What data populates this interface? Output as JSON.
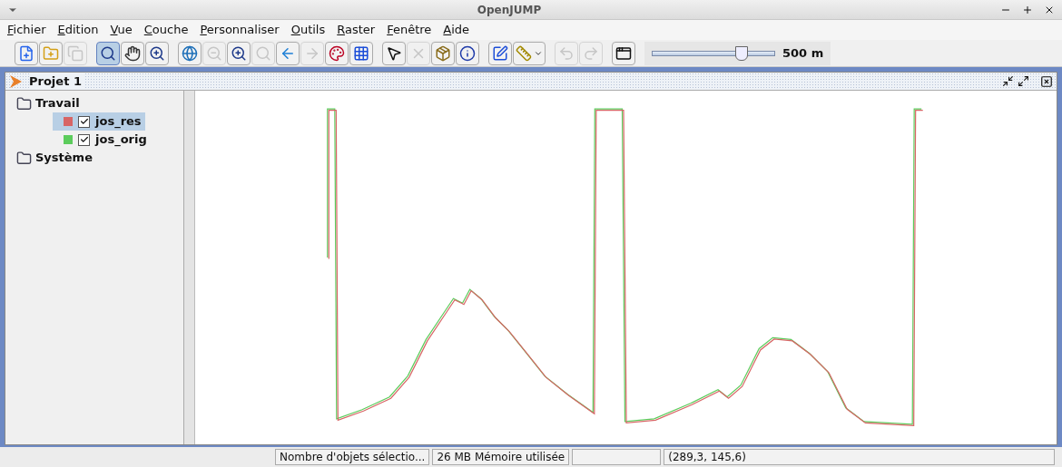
{
  "window": {
    "title": "OpenJUMP"
  },
  "menu": [
    "Fichier",
    "Edition",
    "Vue",
    "Couche",
    "Personnaliser",
    "Outils",
    "Raster",
    "Fenêtre",
    "Aide"
  ],
  "toolbar": [
    [
      {
        "selected": false,
        "disabled": false
      },
      {
        "selected": false,
        "disabled": false
      },
      {
        "selected": false,
        "disabled": true
      }
    ],
    [
      {
        "selected": true,
        "disabled": false
      },
      {
        "selected": false,
        "disabled": false
      },
      {
        "selected": false,
        "disabled": false
      }
    ],
    [
      {
        "selected": false,
        "disabled": false
      },
      {
        "selected": false,
        "disabled": true
      },
      {
        "selected": false,
        "disabled": false
      },
      {
        "selected": false,
        "disabled": true
      },
      {
        "selected": false,
        "disabled": false
      },
      {
        "selected": false,
        "disabled": true
      },
      {
        "selected": false,
        "disabled": false
      },
      {
        "selected": false,
        "disabled": false
      }
    ],
    [
      {
        "selected": false,
        "disabled": false
      },
      {
        "selected": false,
        "disabled": true
      },
      {
        "selected": false,
        "disabled": false
      },
      {
        "selected": false,
        "disabled": false
      }
    ],
    [
      {
        "selected": false,
        "disabled": false
      },
      {
        "selected": false,
        "disabled": false
      }
    ],
    [
      {
        "selected": false,
        "disabled": true
      },
      {
        "selected": false,
        "disabled": true
      }
    ],
    [
      {
        "selected": false,
        "disabled": false
      }
    ]
  ],
  "scale": {
    "level": 0.73,
    "reading": "500 m"
  },
  "project": {
    "title": "Projet 1",
    "tree": [
      {
        "label": "Travail",
        "children": [
          {
            "label": "jos_res",
            "color": "#d76565",
            "checked": true,
            "selected": true
          },
          {
            "label": "jos_orig",
            "color": "#5ccc5c",
            "checked": true,
            "selected": false
          }
        ]
      },
      {
        "label": "Système"
      }
    ]
  },
  "status_bar": {
    "selection": "Nombre d'objets sélectio...",
    "memory": "26 MB Mémoire utilisée",
    "coordinates": "(289,3, 145,6)"
  }
}
